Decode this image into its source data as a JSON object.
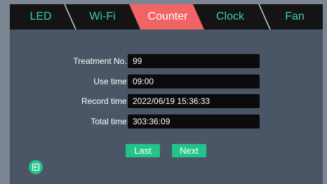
{
  "tabs": [
    {
      "label": "LED",
      "active": false
    },
    {
      "label": "Wi-Fi",
      "active": false
    },
    {
      "label": "Counter",
      "active": true
    },
    {
      "label": "Clock",
      "active": false
    },
    {
      "label": "Fan",
      "active": false
    }
  ],
  "form": {
    "treatment_no": {
      "label": "Treatment No.:",
      "value": "99"
    },
    "use_time": {
      "label": "Use time:",
      "value": "09:00"
    },
    "record_time": {
      "label": "Record time:",
      "value": "2022/06/19 15:36:33"
    },
    "total_time": {
      "label": "Total time:",
      "value": "303:36:09"
    }
  },
  "buttons": {
    "last": "Last",
    "next": "Next"
  },
  "icons": {
    "back": "return-arrow-icon"
  },
  "colors": {
    "accent_green": "#22c48a",
    "tab_text_green": "#3fcf9a",
    "active_tab": "#f06464",
    "tab_bar": "#141414",
    "panel": "#4a5565",
    "field_bg": "#0b0b0b"
  }
}
